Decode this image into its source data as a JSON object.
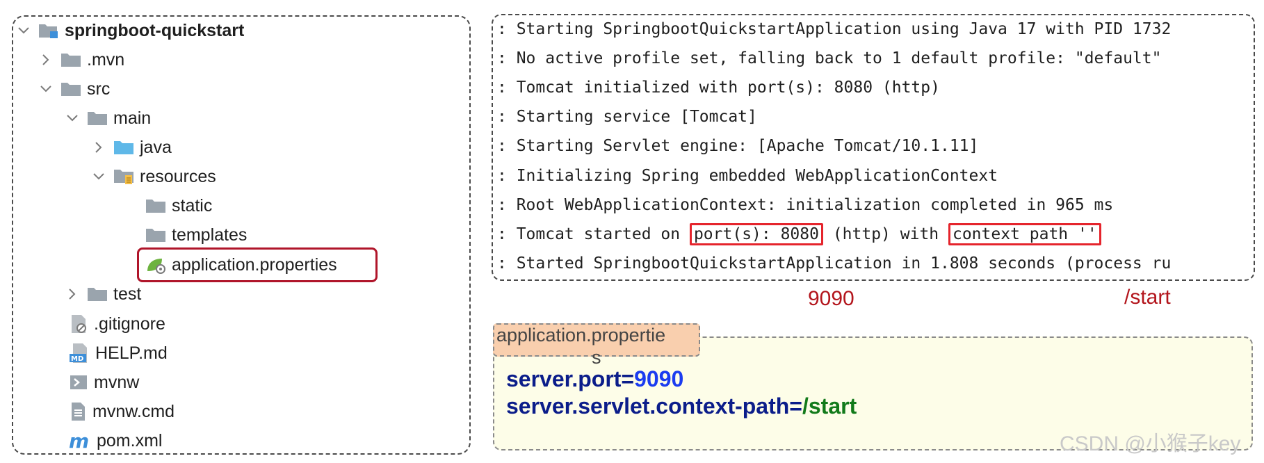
{
  "project_tree": {
    "items": [
      {
        "label": "springboot-quickstart",
        "icon": "project-folder-icon",
        "expanded": true
      },
      {
        "label": ".mvn",
        "icon": "folder-icon",
        "expanded": false
      },
      {
        "label": "src",
        "icon": "folder-icon",
        "expanded": true
      },
      {
        "label": "main",
        "icon": "folder-icon",
        "expanded": true
      },
      {
        "label": "java",
        "icon": "source-folder-icon",
        "expanded": false
      },
      {
        "label": "resources",
        "icon": "resources-folder-icon",
        "expanded": true
      },
      {
        "label": "static",
        "icon": "folder-icon"
      },
      {
        "label": "templates",
        "icon": "folder-icon"
      },
      {
        "label": "application.properties",
        "icon": "spring-properties-icon",
        "highlighted": true
      },
      {
        "label": "test",
        "icon": "folder-icon",
        "expanded": false
      },
      {
        "label": ".gitignore",
        "icon": "gitignore-file-icon"
      },
      {
        "label": "HELP.md",
        "icon": "markdown-file-icon"
      },
      {
        "label": "mvnw",
        "icon": "shell-script-icon"
      },
      {
        "label": "mvnw.cmd",
        "icon": "text-file-icon"
      },
      {
        "label": "pom.xml",
        "icon": "maven-pom-icon"
      }
    ]
  },
  "console": {
    "lines": [
      ": Starting SpringbootQuickstartApplication using Java 17 with PID 1732",
      ": No active profile set, falling back to 1 default profile: \"default\"",
      ": Tomcat initialized with port(s): 8080 (http)",
      ": Starting service [Tomcat]",
      ": Starting Servlet engine: [Apache Tomcat/10.1.11]",
      ": Initializing Spring embedded WebApplicationContext",
      ": Root WebApplicationContext: initialization completed in 965 ms",
      ": Started SpringbootQuickstartApplication in 1.808 seconds (process ru"
    ],
    "started_line": {
      "prefix": ": Tomcat started on ",
      "port_part": "port(s): 8080",
      "middle": " (http) with ",
      "context_part": "context path ''"
    }
  },
  "annotations": {
    "port_value": "9090",
    "context_value": "/start"
  },
  "properties_file": {
    "tab_label": "application.propertie",
    "tab_label_wrap": "s",
    "lines": [
      {
        "key": "server.port",
        "eq": "=",
        "value": "9090"
      },
      {
        "key": "server.servlet.context-path",
        "eq": "=",
        "value": "/start"
      }
    ]
  },
  "watermark": "CSDN @小猴子key",
  "colors": {
    "highlight_border": "#b0152a",
    "console_box": "#e5242c",
    "annotation_text": "#b3151c",
    "prop_key": "#0b1d8a",
    "prop_port_value": "#1b3cf0",
    "prop_path_value": "#127a1a",
    "prop_bg": "#fdfde8",
    "tab_bg": "#f9cfae"
  }
}
